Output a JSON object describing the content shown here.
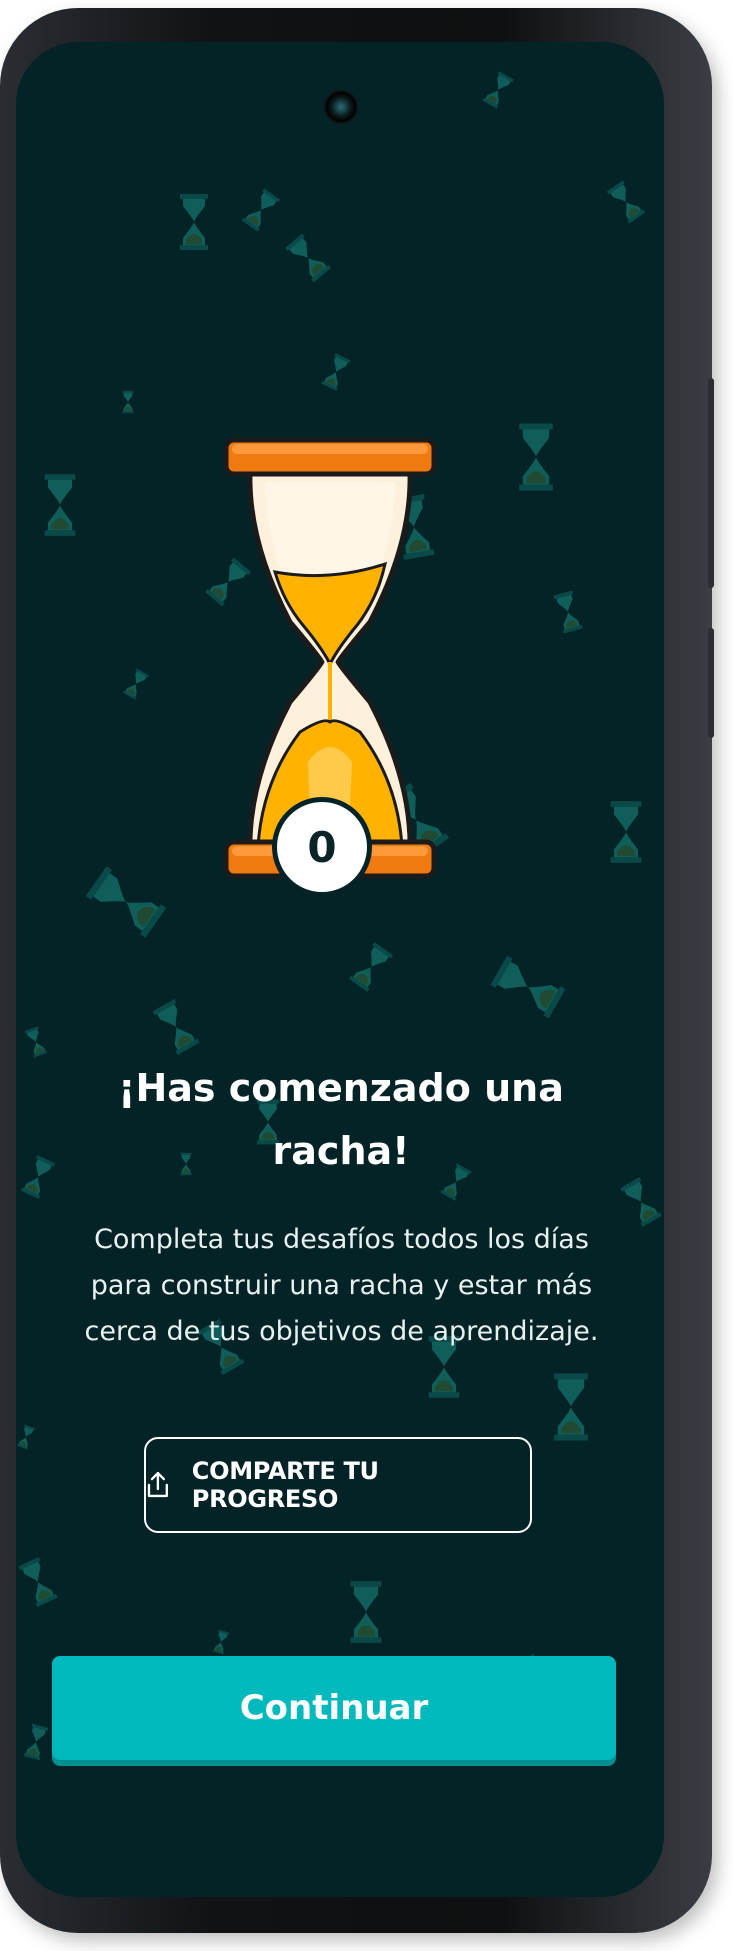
{
  "streak": {
    "count": "0"
  },
  "heading": "¡Has comenzado una racha!",
  "description": "Completa tus desafíos todos los días para construir una racha y estar más cerca de tus objetivos de aprendizaje.",
  "share_button": {
    "label": "COMPARTE TU PROGRESO",
    "icon": "share-icon"
  },
  "continue_button": {
    "label": "Continuar"
  },
  "colors": {
    "background": "#032326",
    "accent": "#00b9bd",
    "hourglass_frame": "#f07a10",
    "sand": "#ffb300"
  }
}
